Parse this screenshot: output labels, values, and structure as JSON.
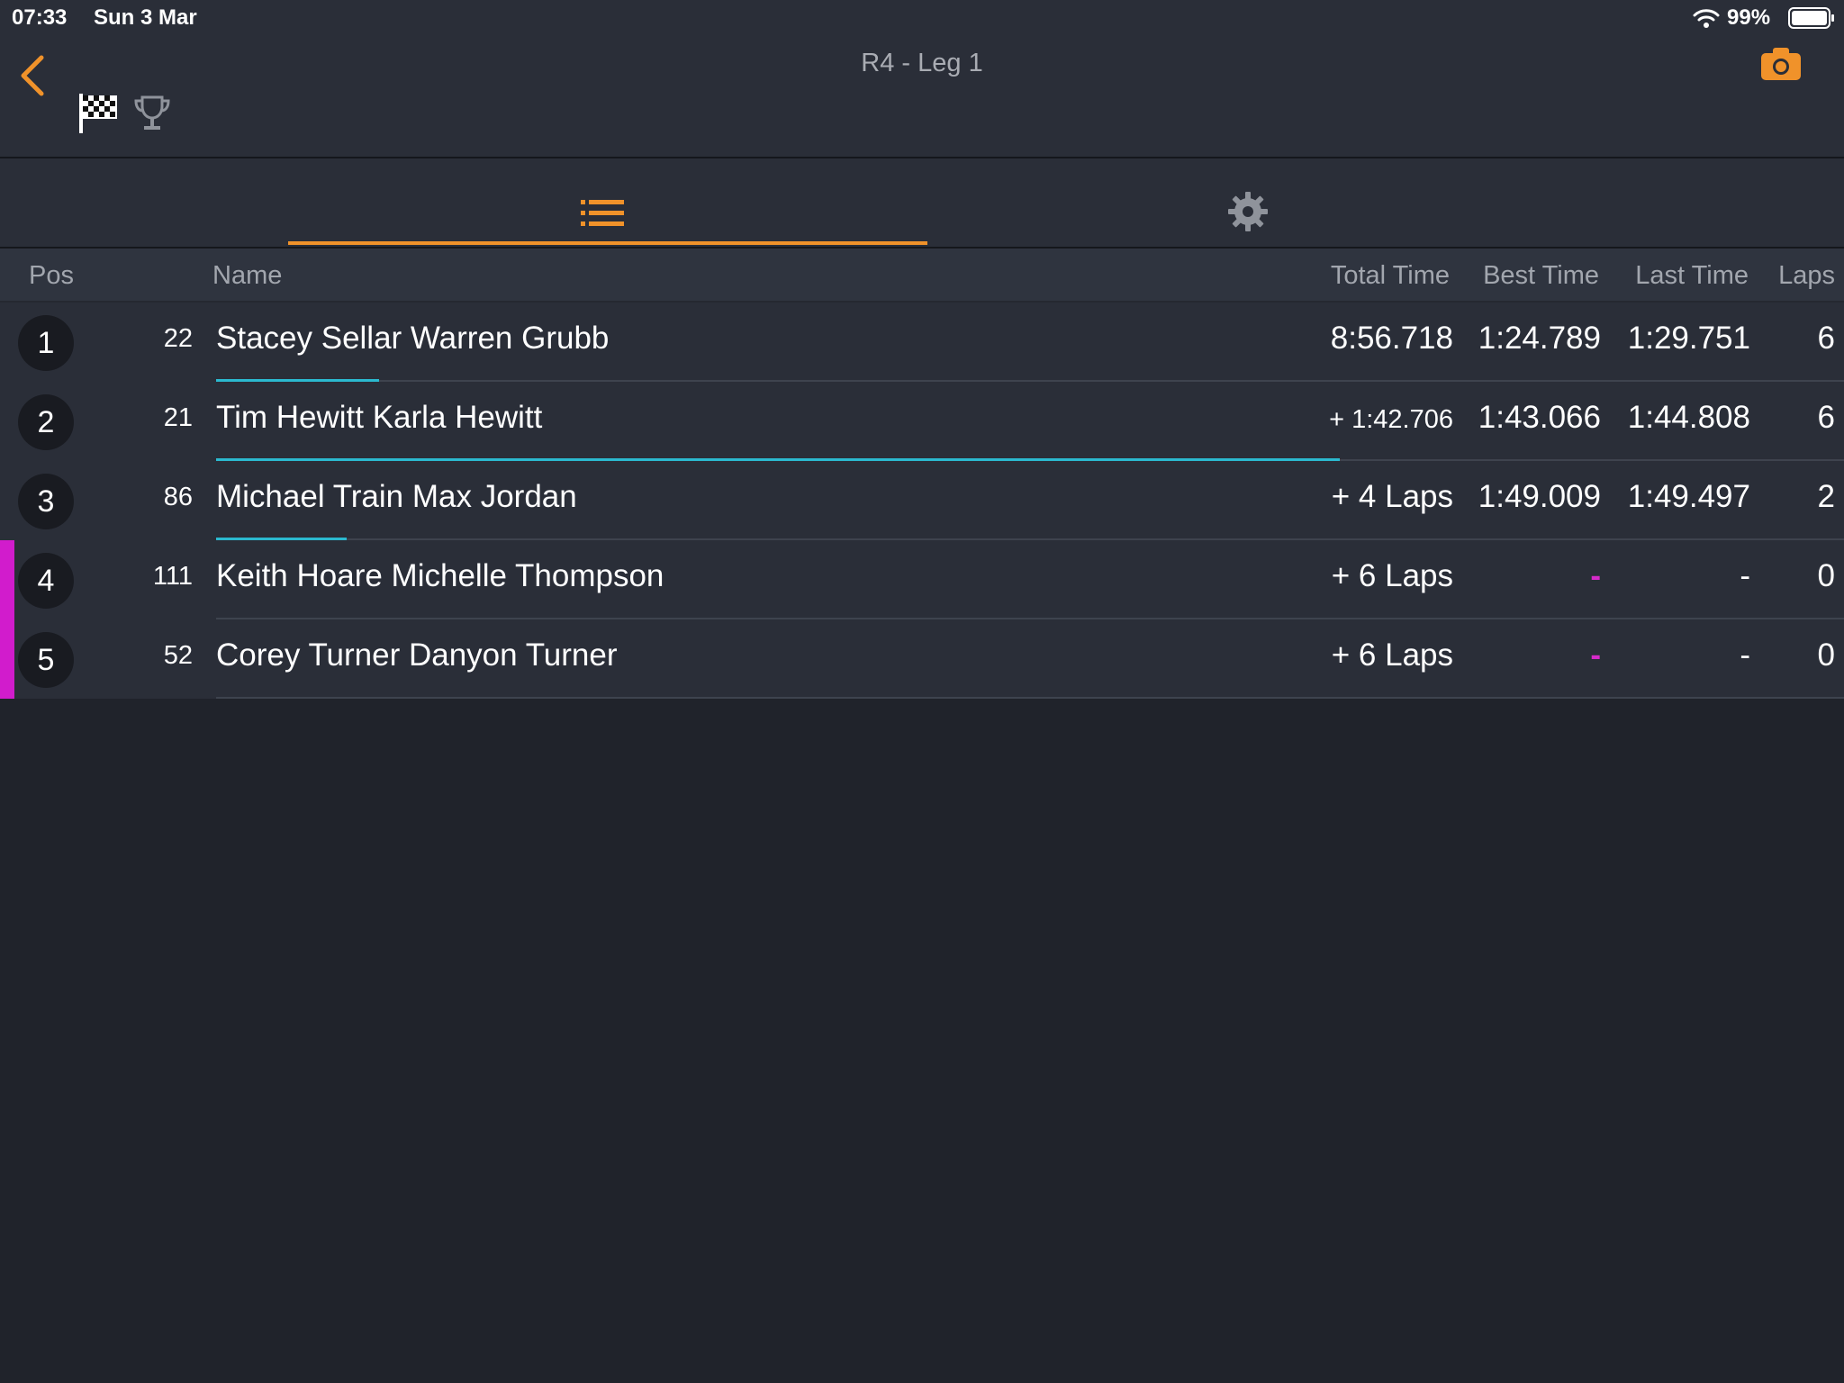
{
  "status_bar": {
    "time": "07:33",
    "date": "Sun 3 Mar",
    "battery": "99%"
  },
  "header": {
    "title": "R4 - Leg 1",
    "icons": [
      "back-chevron-icon",
      "checkered-flag-icon",
      "trophy-icon",
      "camera-icon"
    ]
  },
  "tabs": [
    {
      "name": "list",
      "icon": "list-icon",
      "active": true
    },
    {
      "name": "settings",
      "icon": "gear-icon",
      "active": false
    }
  ],
  "table": {
    "columns": {
      "pos": "Pos",
      "name": "Name",
      "total": "Total Time",
      "best": "Best Time",
      "last": "Last Time",
      "laps": "Laps"
    },
    "rows": [
      {
        "pos": "1",
        "car": "22",
        "name": "Stacey Sellar Warren Grubb",
        "total": "8:56.718",
        "best": "1:24.789",
        "last": "1:29.751",
        "laps": "6",
        "progress": 0.1
      },
      {
        "pos": "2",
        "car": "21",
        "name": "Tim Hewitt Karla Hewitt",
        "total": "+ 1:42.706",
        "best": "1:43.066",
        "last": "1:44.808",
        "laps": "6",
        "progress": 0.69
      },
      {
        "pos": "3",
        "car": "86",
        "name": "Michael Train Max Jordan",
        "total": "+ 4 Laps",
        "best": "1:49.009",
        "last": "1:49.497",
        "laps": "2",
        "progress": 0.08
      },
      {
        "pos": "4",
        "car": "111",
        "name": "Keith Hoare Michelle Thompson",
        "total": "+ 6 Laps",
        "best": "-",
        "last": "-",
        "laps": "0",
        "progress": 0
      },
      {
        "pos": "5",
        "car": "52",
        "name": "Corey Turner Danyon Turner",
        "total": "+ 6 Laps",
        "best": "-",
        "last": "-",
        "laps": "0",
        "progress": 0
      }
    ]
  },
  "colors": {
    "accent": "#f0922a",
    "progress": "#2bb9cf",
    "flag_stripe": "#d11ccc",
    "background": "#20232b",
    "panel": "#2a2e38"
  }
}
